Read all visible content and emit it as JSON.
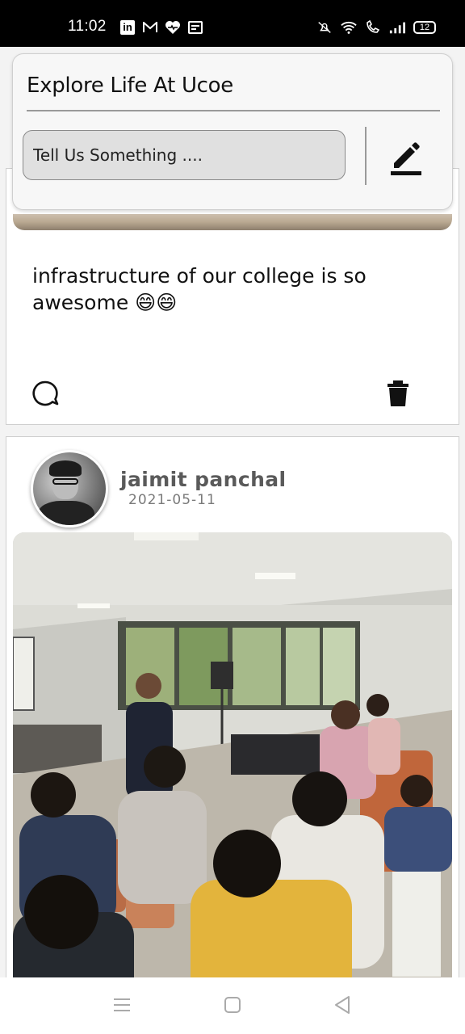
{
  "status_bar": {
    "time": "11:02",
    "battery": "12"
  },
  "header": {
    "title": "Explore Life At Ucoe",
    "input_placeholder": "Tell Us Something ....",
    "input_value": ""
  },
  "posts": [
    {
      "text": "infrastructure of our college is so awesome 😄😄"
    },
    {
      "author": "jaimit panchal",
      "date": "2021-05-11"
    }
  ],
  "colors": {
    "header_bg": "#f7f7f7",
    "input_bg": "#e0e0e0",
    "author_name": "#5a5a5a",
    "date_text": "#7a7a7a"
  },
  "icons": [
    "linkedin-icon",
    "gmail-icon",
    "health-icon",
    "news-icon",
    "mute-icon",
    "wifi-icon",
    "wifi-call-icon",
    "signal-icon",
    "battery-icon",
    "edit-icon",
    "comment-icon",
    "delete-icon",
    "menu-icon",
    "home-icon",
    "back-icon"
  ]
}
